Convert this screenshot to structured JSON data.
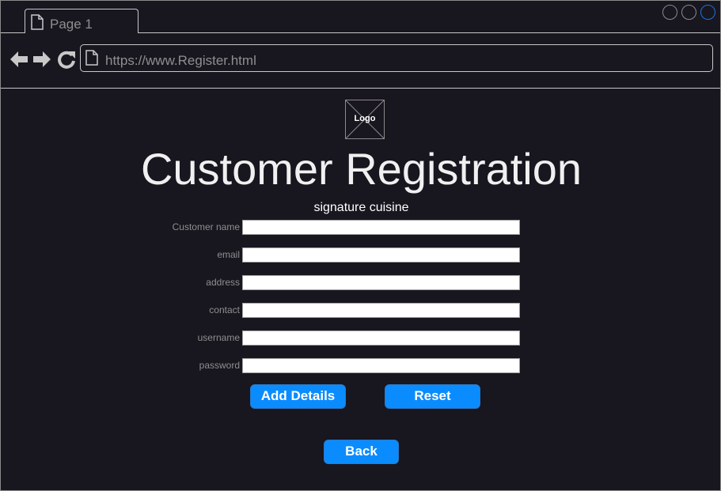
{
  "browser": {
    "tab_label": "Page 1",
    "url": "https://www.Register.html"
  },
  "page": {
    "logo_label": "Logo",
    "title": "Customer Registration",
    "subtitle": "signature cuisine"
  },
  "form": {
    "fields": [
      {
        "label": "Customer name",
        "value": ""
      },
      {
        "label": "email",
        "value": ""
      },
      {
        "label": "address",
        "value": ""
      },
      {
        "label": "contact",
        "value": ""
      },
      {
        "label": "username",
        "value": ""
      },
      {
        "label": "password",
        "value": ""
      }
    ],
    "add_button": "Add Details",
    "reset_button": "Reset",
    "back_button": "Back"
  },
  "colors": {
    "background": "#18161f",
    "button": "#0a8cff",
    "window_control_active": "#1a73e8"
  },
  "icons": [
    "page-icon",
    "back-arrow-icon",
    "forward-arrow-icon",
    "reload-icon",
    "window-control-icon",
    "logo-placeholder-icon"
  ]
}
